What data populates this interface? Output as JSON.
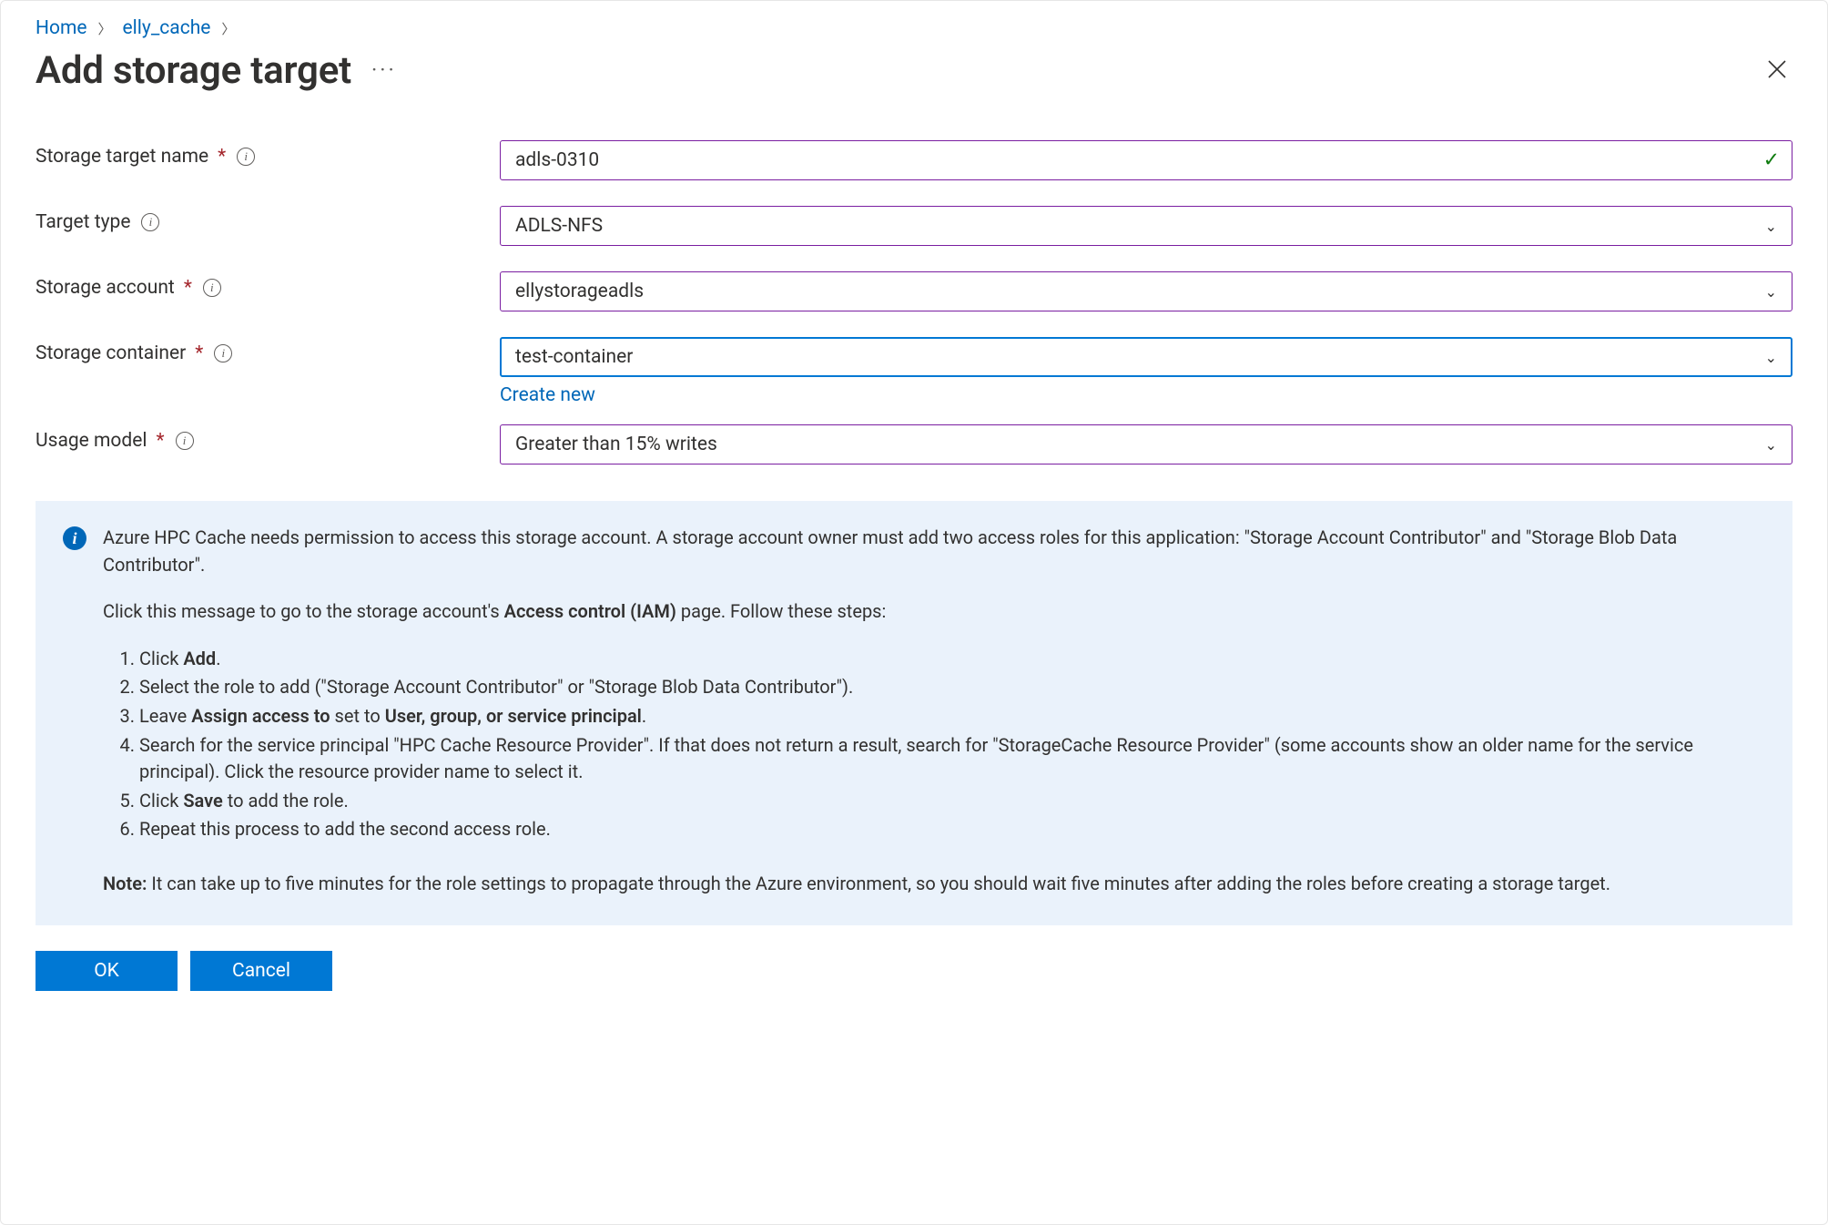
{
  "breadcrumb": {
    "home": "Home",
    "cache": "elly_cache"
  },
  "pageTitle": "Add storage target",
  "fields": {
    "storageTargetName": {
      "label": "Storage target name",
      "value": "adls-0310",
      "required": true
    },
    "targetType": {
      "label": "Target type",
      "value": "ADLS-NFS",
      "required": false
    },
    "storageAccount": {
      "label": "Storage account",
      "value": "ellystorageadls",
      "required": true
    },
    "storageContainer": {
      "label": "Storage container",
      "value": "test-container",
      "required": true,
      "createNew": "Create new"
    },
    "usageModel": {
      "label": "Usage model",
      "value": "Greater than 15% writes",
      "required": true
    }
  },
  "notice": {
    "intro1a": "Azure HPC Cache needs permission to access this storage account. A storage account owner must add two access roles for this application: \"Storage Account Contributor\" and \"Storage Blob Data Contributor\".",
    "intro2a": "Click this message to go to the storage account's ",
    "intro2b": "Access control (IAM)",
    "intro2c": " page. Follow these steps:",
    "steps": {
      "s1a": "Click ",
      "s1b": "Add",
      "s1c": ".",
      "s2": "Select the role to add (\"Storage Account Contributor\" or \"Storage Blob Data Contributor\").",
      "s3a": "Leave ",
      "s3b": "Assign access to",
      "s3c": " set to ",
      "s3d": "User, group, or service principal",
      "s3e": ".",
      "s4": "Search for the service principal \"HPC Cache Resource Provider\". If that does not return a result, search for \"StorageCache Resource Provider\" (some accounts show an older name for the service principal). Click the resource provider name to select it.",
      "s5a": "Click ",
      "s5b": "Save",
      "s5c": " to add the role.",
      "s6": "Repeat this process to add the second access role."
    },
    "note_label": "Note:",
    "note_body": " It can take up to five minutes for the role settings to propagate through the Azure environment, so you should wait five minutes after adding the roles before creating a storage target."
  },
  "buttons": {
    "ok": "OK",
    "cancel": "Cancel"
  }
}
